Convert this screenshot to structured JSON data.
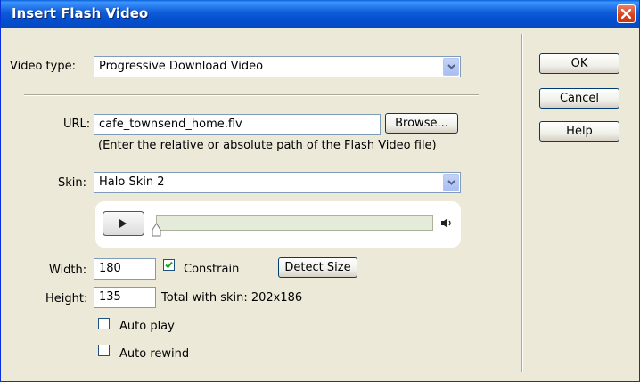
{
  "window": {
    "title": "Insert Flash Video"
  },
  "video_type": {
    "label": "Video type:",
    "value": "Progressive Download Video"
  },
  "url": {
    "label": "URL:",
    "value": "cafe_townsend_home.flv",
    "browse_label": "Browse...",
    "hint": "(Enter the relative or absolute path of the Flash Video file)"
  },
  "skin": {
    "label": "Skin:",
    "value": "Halo Skin 2"
  },
  "size": {
    "width_label": "Width:",
    "width_value": "180",
    "height_label": "Height:",
    "height_value": "135",
    "constrain_label": "Constrain",
    "constrain_checked": true,
    "detect_label": "Detect Size",
    "total_text": "Total with skin: 202x186"
  },
  "options": {
    "auto_play_label": "Auto play",
    "auto_play_checked": false,
    "auto_rewind_label": "Auto rewind",
    "auto_rewind_checked": false
  },
  "buttons": {
    "ok": "OK",
    "cancel": "Cancel",
    "help": "Help"
  },
  "icons": {
    "close": "close-icon",
    "play": "play-icon",
    "volume": "volume-icon",
    "dropdown": "chevron-down-icon",
    "check": "check-icon"
  }
}
